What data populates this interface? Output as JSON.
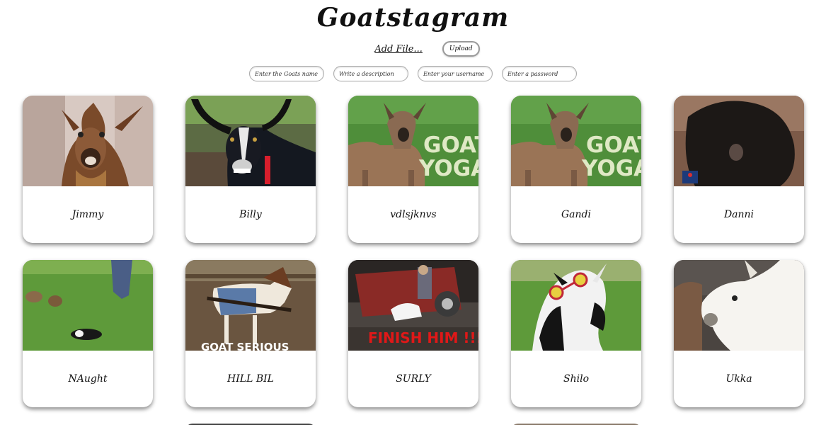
{
  "header": {
    "title": "Goatstagram"
  },
  "upload": {
    "add_file_label": "Add File...",
    "upload_label": "Upload"
  },
  "fields": {
    "goat_name_placeholder": "Enter the Goats name",
    "description_placeholder": "Write a description",
    "username_placeholder": "Enter your username",
    "password_placeholder": "Enter a password"
  },
  "goats": [
    {
      "name": "Jimmy"
    },
    {
      "name": "Billy"
    },
    {
      "name": "vdlsjknvs",
      "photo_text": [
        "GOAT",
        "YOGA"
      ]
    },
    {
      "name": "Gandi",
      "photo_text": [
        "GOAT",
        "YOGA"
      ]
    },
    {
      "name": "Danni"
    },
    {
      "name": "NAught"
    },
    {
      "name": "HILL BIL",
      "photo_text": [
        "GOAT SERIOUS"
      ]
    },
    {
      "name": "SURLY",
      "photo_text": [
        "FINISH HIM !!!"
      ]
    },
    {
      "name": "Shilo"
    },
    {
      "name": "Ukka"
    }
  ],
  "colors": {
    "card_shadow": "#555555",
    "finish_text": "#e01818",
    "yoga_text": "#dfe9c5"
  }
}
